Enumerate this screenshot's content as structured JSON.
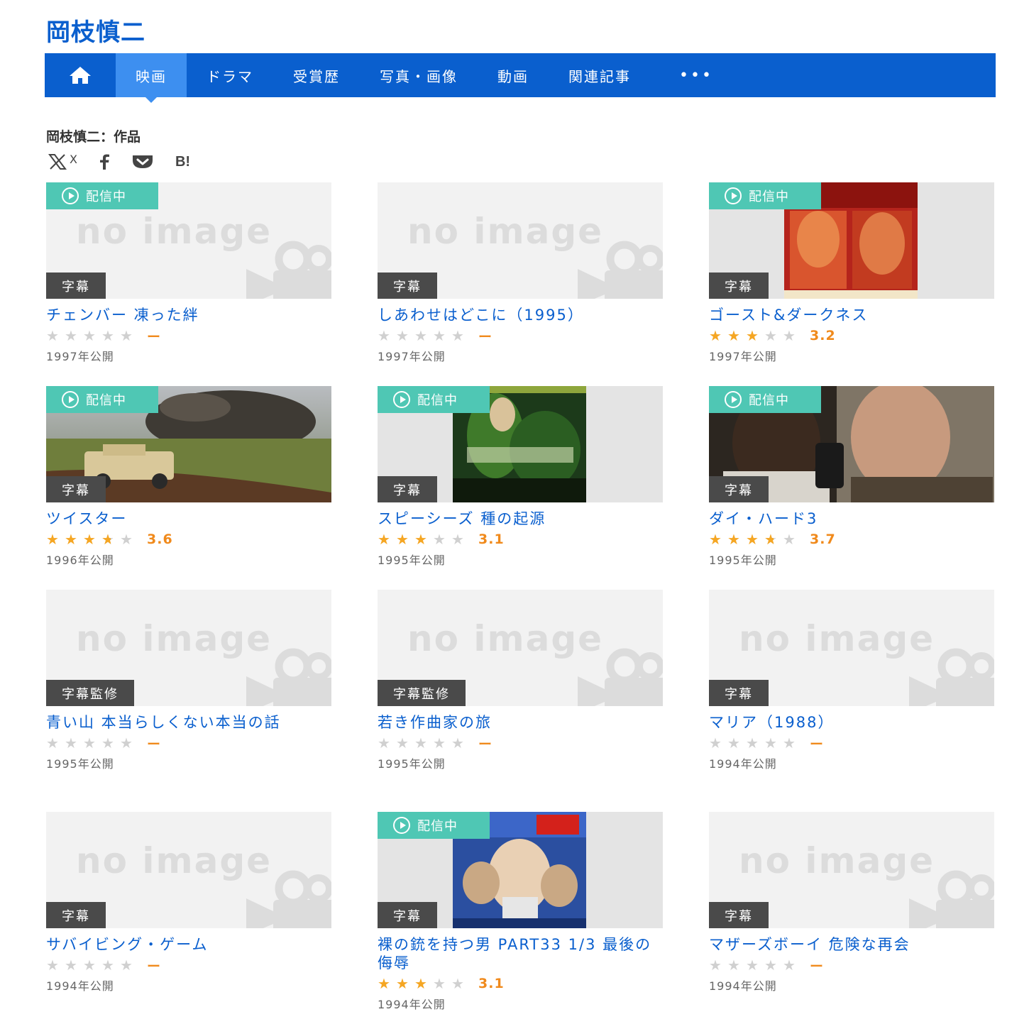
{
  "site": {
    "title": "岡枝慎二"
  },
  "nav": {
    "items": [
      {
        "label": "映画"
      },
      {
        "label": "ドラマ"
      },
      {
        "label": "受賞歴"
      },
      {
        "label": "写真・画像"
      },
      {
        "label": "動画"
      },
      {
        "label": "関連記事"
      }
    ],
    "more": "•••"
  },
  "section": {
    "title": "岡枝慎二：作品"
  },
  "share": {
    "x_label": "X",
    "hatena_label": "B!"
  },
  "labels": {
    "streaming": "配信中",
    "no_image": "no image"
  },
  "colors": {
    "brand": "#0a5fce",
    "nav_active": "#3d8ff0",
    "stream_badge": "#4fc7b4",
    "sub_badge": "#4a4a4a",
    "star": "#f5a623",
    "score": "#f08a1c"
  },
  "movies": [
    {
      "title": "チェンバー 凍った絆",
      "badge": "字幕",
      "streaming": true,
      "rating": 0,
      "score": "ー",
      "year": "1997年公開",
      "image": "none"
    },
    {
      "title": "しあわせはどこに（1995）",
      "badge": "字幕",
      "streaming": false,
      "rating": 0,
      "score": "ー",
      "year": "1997年公開",
      "image": "none"
    },
    {
      "title": "ゴースト&ダークネス",
      "badge": "字幕",
      "streaming": true,
      "rating": 3.2,
      "score": "3.2",
      "year": "1997年公開",
      "image": "poster-ghost"
    },
    {
      "title": "ツイスター",
      "badge": "字幕",
      "streaming": true,
      "rating": 3.6,
      "score": "3.6",
      "year": "1996年公開",
      "image": "wide-twister"
    },
    {
      "title": "スピーシーズ 種の起源",
      "badge": "字幕",
      "streaming": true,
      "rating": 3.1,
      "score": "3.1",
      "year": "1995年公開",
      "image": "poster-species"
    },
    {
      "title": "ダイ・ハード3",
      "badge": "字幕",
      "streaming": true,
      "rating": 3.7,
      "score": "3.7",
      "year": "1995年公開",
      "image": "wide-diehard"
    },
    {
      "title": "青い山 本当らしくない本当の話",
      "badge": "字幕監修",
      "streaming": false,
      "rating": 0,
      "score": "ー",
      "year": "1995年公開",
      "image": "none"
    },
    {
      "title": "若き作曲家の旅",
      "badge": "字幕監修",
      "streaming": false,
      "rating": 0,
      "score": "ー",
      "year": "1995年公開",
      "image": "none"
    },
    {
      "title": "マリア（1988）",
      "badge": "字幕",
      "streaming": false,
      "rating": 0,
      "score": "ー",
      "year": "1994年公開",
      "image": "none"
    },
    {
      "title": "サバイビング・ゲーム",
      "badge": "字幕",
      "streaming": false,
      "rating": 0,
      "score": "ー",
      "year": "1994年公開",
      "image": "none"
    },
    {
      "title": "裸の銃を持つ男 PART33 1/3 最後の侮辱",
      "badge": "字幕",
      "streaming": true,
      "rating": 3.1,
      "score": "3.1",
      "year": "1994年公開",
      "image": "poster-nakedgun"
    },
    {
      "title": "マザーズボーイ 危険な再会",
      "badge": "字幕",
      "streaming": false,
      "rating": 0,
      "score": "ー",
      "year": "1994年公開",
      "image": "none"
    }
  ]
}
